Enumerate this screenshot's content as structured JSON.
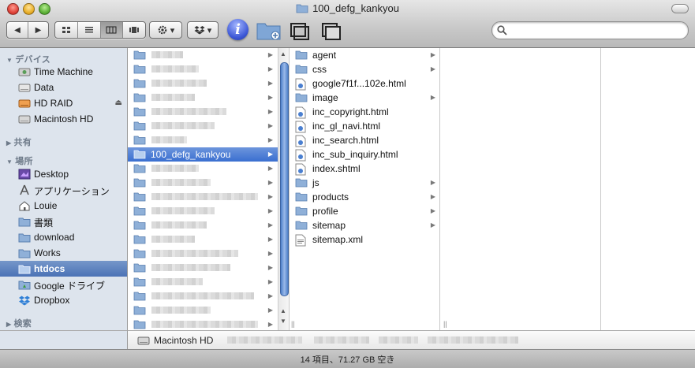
{
  "window": {
    "title": "100_defg_kankyou"
  },
  "toolbar": {
    "back_label": "◀",
    "forward_label": "▶",
    "view_icons": [
      "icon-view-icon",
      "list-view-icon",
      "column-view-icon",
      "coverflow-view-icon"
    ],
    "action_label": "▾",
    "dropbox_label": "▾",
    "info_label": "i",
    "search": {
      "placeholder": "",
      "value": ""
    }
  },
  "sidebar": {
    "sections": {
      "devices": "デバイス",
      "shared": "共有",
      "places": "場所",
      "search": "検索"
    },
    "devices": [
      {
        "label": "Time Machine",
        "icon": "time-machine-drive-icon"
      },
      {
        "label": "Data",
        "icon": "drive-icon"
      },
      {
        "label": "HD RAID",
        "icon": "raid-drive-icon"
      },
      {
        "label": "Macintosh HD",
        "icon": "drive-icon"
      }
    ],
    "places": [
      {
        "label": "Desktop",
        "icon": "desktop-icon"
      },
      {
        "label": "アプリケーション",
        "icon": "applications-icon"
      },
      {
        "label": "Louie",
        "icon": "home-icon"
      },
      {
        "label": "書類",
        "icon": "folder-icon"
      },
      {
        "label": "download",
        "icon": "folder-icon"
      },
      {
        "label": "Works",
        "icon": "folder-icon"
      },
      {
        "label": "htdocs",
        "icon": "folder-icon",
        "selected": true
      },
      {
        "label": "Google ドライブ",
        "icon": "google-drive-icon"
      },
      {
        "label": "Dropbox",
        "icon": "dropbox-icon"
      }
    ]
  },
  "columns": {
    "col1": {
      "selected_label": "100_defg_kankyou",
      "selected_index": 7,
      "row_count": 20
    },
    "col2": {
      "items": [
        {
          "name": "agent",
          "type": "folder"
        },
        {
          "name": "css",
          "type": "folder"
        },
        {
          "name": "google7f1f...102e.html",
          "type": "html"
        },
        {
          "name": "image",
          "type": "folder"
        },
        {
          "name": "inc_copyright.html",
          "type": "html"
        },
        {
          "name": "inc_gl_navi.html",
          "type": "html"
        },
        {
          "name": "inc_search.html",
          "type": "html"
        },
        {
          "name": "inc_sub_inquiry.html",
          "type": "html"
        },
        {
          "name": "index.shtml",
          "type": "html"
        },
        {
          "name": "js",
          "type": "folder"
        },
        {
          "name": "products",
          "type": "folder"
        },
        {
          "name": "profile",
          "type": "folder"
        },
        {
          "name": "sitemap",
          "type": "folder"
        },
        {
          "name": "sitemap.xml",
          "type": "xml"
        }
      ]
    }
  },
  "pathbar": {
    "root": "Macintosh HD"
  },
  "status": {
    "text": "14 項目、71.27 GB 空き"
  },
  "colors": {
    "selection": "#3a6fd0",
    "sidebar_bg": "#dde4ed",
    "folder": "#8fb0d8"
  }
}
